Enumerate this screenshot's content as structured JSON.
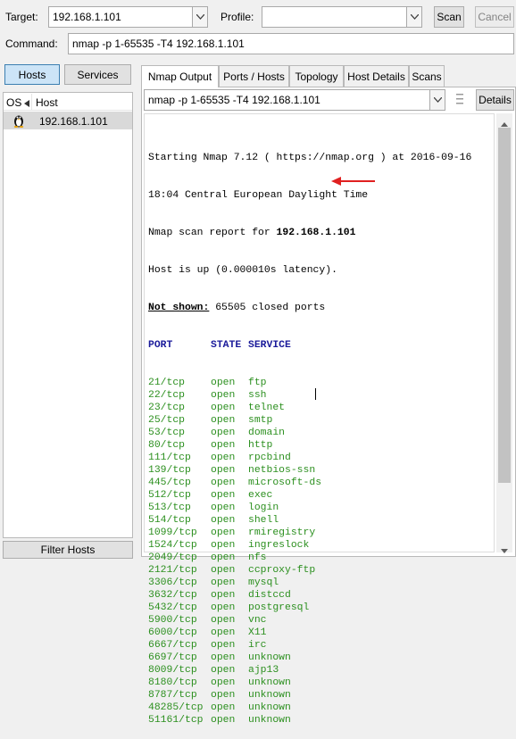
{
  "toolbar": {
    "target_label": "Target:",
    "target_value": "192.168.1.101",
    "profile_label": "Profile:",
    "profile_value": "",
    "scan_label": "Scan",
    "cancel_label": "Cancel",
    "command_label": "Command:",
    "command_value": "nmap -p 1-65535 -T4 192.168.1.101"
  },
  "sidebar": {
    "hosts_tab": "Hosts",
    "services_tab": "Services",
    "col_os": "OS",
    "col_host": "Host",
    "hosts": [
      {
        "address": "192.168.1.101",
        "icon": "linux-penguin-icon"
      }
    ],
    "filter_label": "Filter Hosts"
  },
  "main": {
    "tabs": [
      {
        "label": "Nmap Output",
        "active": true
      },
      {
        "label": "Ports / Hosts",
        "active": false
      },
      {
        "label": "Topology",
        "active": false
      },
      {
        "label": "Host Details",
        "active": false
      },
      {
        "label": "Scans",
        "active": false
      }
    ],
    "output_select": "nmap -p 1-65535 -T4 192.168.1.101",
    "details_label": "Details"
  },
  "output": {
    "start_prefix": "Starting Nmap 7.12 ( ",
    "start_url": "https://nmap.org",
    "start_suffix": " ) at 2016-09-16",
    "start_line2": "18:04 Central European Daylight Time",
    "report_prefix": "Nmap scan report for ",
    "report_host": "192.168.1.101",
    "host_up": "Host is up (0.000010s latency).",
    "not_shown_label": "Not shown:",
    "not_shown_value": " 65505 closed ports",
    "hdr_port": "PORT",
    "hdr_state": "STATE",
    "hdr_service": "SERVICE",
    "ports": [
      {
        "port": "21/tcp",
        "state": "open",
        "service": "ftp"
      },
      {
        "port": "22/tcp",
        "state": "open",
        "service": "ssh"
      },
      {
        "port": "23/tcp",
        "state": "open",
        "service": "telnet"
      },
      {
        "port": "25/tcp",
        "state": "open",
        "service": "smtp"
      },
      {
        "port": "53/tcp",
        "state": "open",
        "service": "domain"
      },
      {
        "port": "80/tcp",
        "state": "open",
        "service": "http"
      },
      {
        "port": "111/tcp",
        "state": "open",
        "service": "rpcbind"
      },
      {
        "port": "139/tcp",
        "state": "open",
        "service": "netbios-ssn"
      },
      {
        "port": "445/tcp",
        "state": "open",
        "service": "microsoft-ds"
      },
      {
        "port": "512/tcp",
        "state": "open",
        "service": "exec"
      },
      {
        "port": "513/tcp",
        "state": "open",
        "service": "login"
      },
      {
        "port": "514/tcp",
        "state": "open",
        "service": "shell"
      },
      {
        "port": "1099/tcp",
        "state": "open",
        "service": "rmiregistry"
      },
      {
        "port": "1524/tcp",
        "state": "open",
        "service": "ingreslock"
      },
      {
        "port": "2049/tcp",
        "state": "open",
        "service": "nfs"
      },
      {
        "port": "2121/tcp",
        "state": "open",
        "service": "ccproxy-ftp"
      },
      {
        "port": "3306/tcp",
        "state": "open",
        "service": "mysql"
      },
      {
        "port": "3632/tcp",
        "state": "open",
        "service": "distccd"
      },
      {
        "port": "5432/tcp",
        "state": "open",
        "service": "postgresql"
      },
      {
        "port": "5900/tcp",
        "state": "open",
        "service": "vnc"
      },
      {
        "port": "6000/tcp",
        "state": "open",
        "service": "X11"
      },
      {
        "port": "6667/tcp",
        "state": "open",
        "service": "irc"
      },
      {
        "port": "6697/tcp",
        "state": "open",
        "service": "unknown"
      },
      {
        "port": "8009/tcp",
        "state": "open",
        "service": "ajp13"
      },
      {
        "port": "8180/tcp",
        "state": "open",
        "service": "unknown"
      },
      {
        "port": "8787/tcp",
        "state": "open",
        "service": "unknown"
      },
      {
        "port": "48285/tcp",
        "state": "open",
        "service": "unknown"
      },
      {
        "port": "51161/tcp",
        "state": "open",
        "service": "unknown"
      }
    ]
  },
  "colors": {
    "open_ports": "#2b8f1e",
    "annotation_arrow": "#e02020",
    "url": "#000000"
  }
}
